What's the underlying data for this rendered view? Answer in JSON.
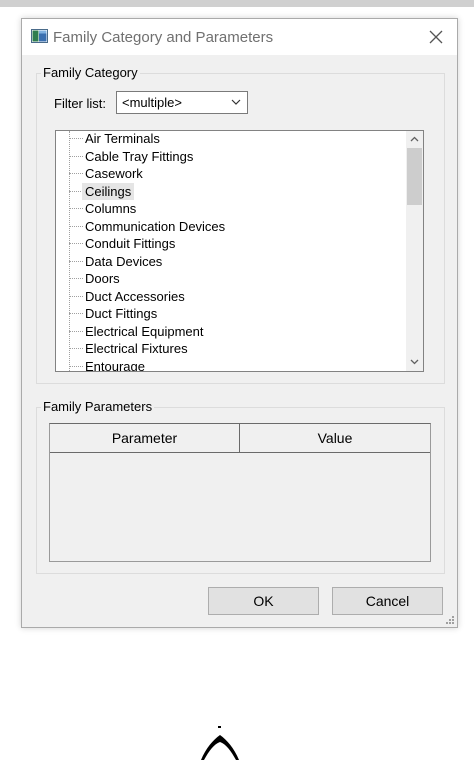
{
  "window": {
    "title": "Family Category and Parameters",
    "app_icon": "revit-family-icon",
    "close_icon": "close-icon"
  },
  "family_category": {
    "group_label": "Family Category",
    "filter_label": "Filter list:",
    "filter_value": "<multiple>",
    "categories": [
      "Air Terminals",
      "Cable Tray Fittings",
      "Casework",
      "Ceilings",
      "Columns",
      "Communication Devices",
      "Conduit Fittings",
      "Data Devices",
      "Doors",
      "Duct Accessories",
      "Duct Fittings",
      "Electrical Equipment",
      "Electrical Fixtures",
      "Entourage"
    ],
    "selected_category": "Ceilings"
  },
  "family_parameters": {
    "group_label": "Family Parameters",
    "columns": [
      "Parameter",
      "Value"
    ],
    "rows": []
  },
  "buttons": {
    "ok": "OK",
    "cancel": "Cancel"
  },
  "colors": {
    "dialog_bg": "#f0f0f0",
    "selection_bg": "#e5e5e5",
    "button_bg": "#e1e1e1"
  }
}
